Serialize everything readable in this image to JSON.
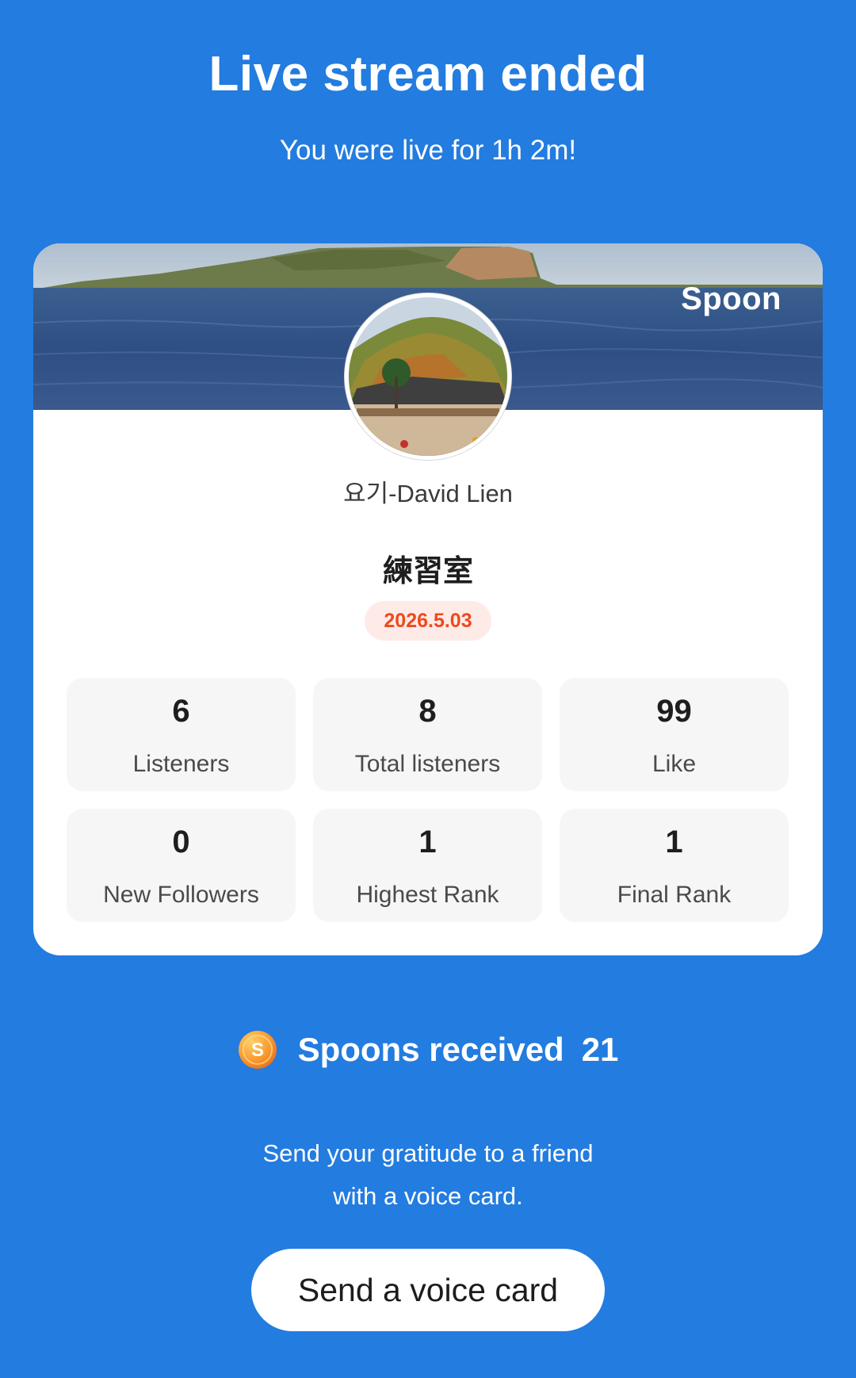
{
  "header": {
    "title": "Live stream ended",
    "subtitle": "You were live for 1h 2m!"
  },
  "card": {
    "brand": "Spoon",
    "host_name": "요기-David Lien",
    "room_title": "練習室",
    "date": "2026.5.03",
    "date_badge_color": "#ee4a1c",
    "stats": [
      {
        "value": "6",
        "label": "Listeners"
      },
      {
        "value": "8",
        "label": "Total listeners"
      },
      {
        "value": "99",
        "label": "Like"
      },
      {
        "value": "0",
        "label": "New Followers"
      },
      {
        "value": "1",
        "label": "Highest Rank"
      },
      {
        "value": "1",
        "label": "Final Rank"
      }
    ]
  },
  "spoons": {
    "label": "Spoons received",
    "count": "21",
    "coin_letter": "S"
  },
  "gratitude": {
    "line1": "Send your gratitude to a friend",
    "line2": "with a voice card."
  },
  "action": {
    "button_label": "Send a voice card"
  },
  "colors": {
    "background": "#237cdf",
    "card": "#ffffff",
    "stat_tile": "#f6f6f6"
  }
}
